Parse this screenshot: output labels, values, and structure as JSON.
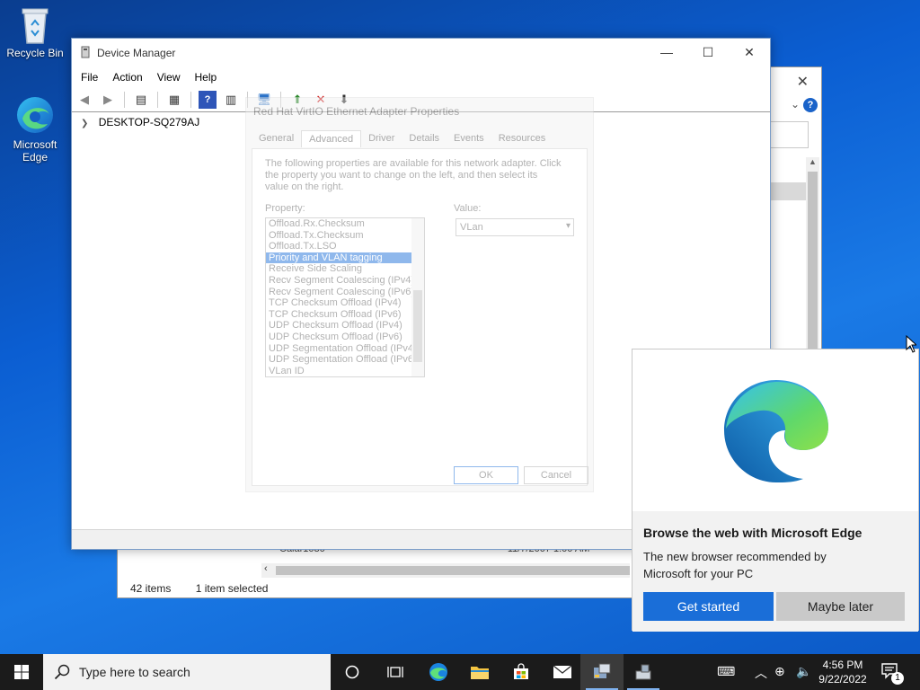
{
  "desktop": {
    "icons": [
      {
        "label": "Recycle Bin"
      },
      {
        "label": "Microsoft Edge"
      }
    ]
  },
  "explorer": {
    "status": {
      "items_count": "42 items",
      "selected": "1 item selected"
    },
    "ghost_row": {
      "name": "Calar1030",
      "date": "11/7/2007 1:00 AM"
    }
  },
  "device_manager": {
    "title": "Device Manager",
    "menu": [
      "File",
      "Action",
      "View",
      "Help"
    ],
    "tree_root": "DESKTOP-SQ279AJ"
  },
  "properties_dialog": {
    "title": "Red Hat VirtIO Ethernet Adapter Properties",
    "tabs": [
      "General",
      "Advanced",
      "Driver",
      "Details",
      "Events",
      "Resources"
    ],
    "active_tab": "Advanced",
    "description": "The following properties are available for this network adapter. Click the property you want to change on the left, and then select its value on the right.",
    "property_label": "Property:",
    "value_label": "Value:",
    "properties": [
      "Offload.Rx.Checksum",
      "Offload.Tx.Checksum",
      "Offload.Tx.LSO",
      "Priority and VLAN tagging",
      "Receive Side Scaling",
      "Recv Segment Coalescing (IPv4)",
      "Recv Segment Coalescing (IPv6)",
      "TCP Checksum Offload (IPv4)",
      "TCP Checksum Offload (IPv6)",
      "UDP Checksum Offload (IPv4)",
      "UDP Checksum Offload (IPv6)",
      "UDP Segmentation Offload (IPv4)",
      "UDP Segmentation Offload (IPv6)",
      "VLan ID"
    ],
    "selected_property": "Priority and VLAN tagging",
    "value": "VLan",
    "ok_label": "OK",
    "cancel_label": "Cancel"
  },
  "edge_toast": {
    "headline": "Browse the web with Microsoft Edge",
    "body": "The new browser recommended by Microsoft for your PC",
    "primary_label": "Get started",
    "secondary_label": "Maybe later"
  },
  "taskbar": {
    "search_placeholder": "Type here to search",
    "time": "4:56 PM",
    "date": "9/22/2022",
    "notification_count": "1"
  },
  "colors": {
    "accent": "#1a6ed8",
    "taskbar": "#1b1b1b",
    "desktop": "#0b5ed2"
  }
}
